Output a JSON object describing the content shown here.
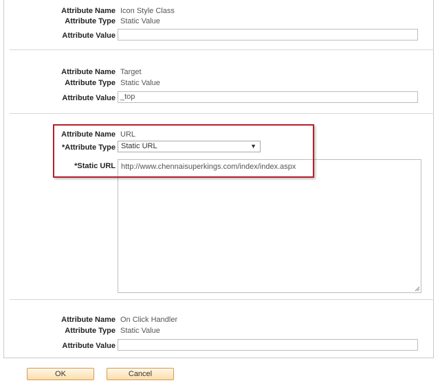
{
  "section1": {
    "attr_name_label": "Attribute Name",
    "attr_name_value": "Icon Style Class",
    "attr_type_label": "Attribute Type",
    "attr_type_value": "Static Value",
    "attr_value_label": "Attribute Value",
    "attr_value": ""
  },
  "section2": {
    "attr_name_label": "Attribute Name",
    "attr_name_value": "Target",
    "attr_type_label": "Attribute Type",
    "attr_type_value": "Static Value",
    "attr_value_label": "Attribute Value",
    "attr_value": "_top"
  },
  "section3": {
    "attr_name_label": "Attribute Name",
    "attr_name_value": "URL",
    "attr_type_label": "*Attribute Type",
    "attr_type_selected": "Static URL",
    "static_url_label": "*Static URL",
    "static_url_value": "http://www.chennaisuperkings.com/index/index.aspx"
  },
  "section4": {
    "attr_name_label": "Attribute Name",
    "attr_name_value": "On Click Handler",
    "attr_type_label": "Attribute Type",
    "attr_type_value": "Static Value",
    "attr_value_label": "Attribute Value",
    "attr_value": ""
  },
  "buttons": {
    "ok_label": "OK",
    "cancel_label": "Cancel"
  },
  "colors": {
    "highlight_border": "#b41f2a",
    "button_border": "#d49a52"
  }
}
